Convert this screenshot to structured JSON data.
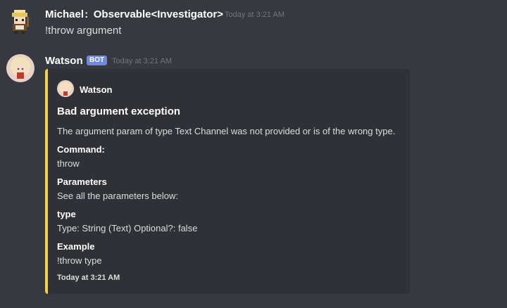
{
  "messages": [
    {
      "author": "Michael : Observable<Investigator>",
      "timestamp": "Today at 3:21 AM",
      "content": "!throw argument"
    },
    {
      "author": "Watson",
      "badge": "BOT",
      "timestamp": "Today at 3:21 AM",
      "embed": {
        "accent_color": "#f1d147",
        "author": "Watson",
        "title": "Bad argument exception",
        "description": "The argument param of type Text Channel was not provided or is of the wrong type.",
        "fields": [
          {
            "name": "Command:",
            "value": "throw"
          },
          {
            "name": "Parameters",
            "value": "See all the parameters below:"
          },
          {
            "name": "type",
            "value": "Type: String (Text) Optional?: false"
          },
          {
            "name": "Example",
            "value": "!throw type"
          }
        ],
        "footer": "Today at 3:21 AM"
      }
    }
  ]
}
